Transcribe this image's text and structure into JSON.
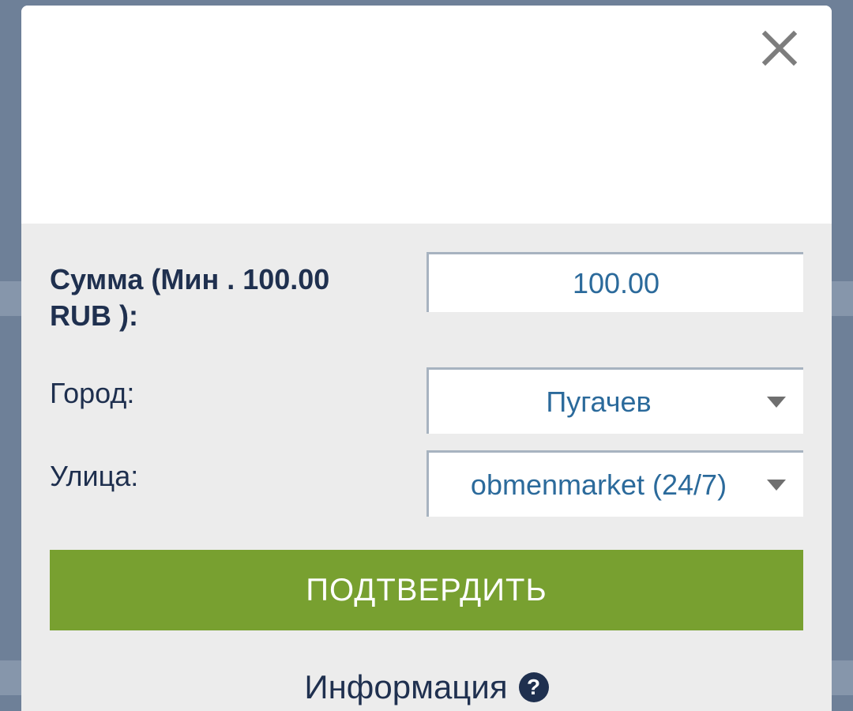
{
  "modal": {
    "close_icon": "close-icon"
  },
  "form": {
    "amount": {
      "label": "Сумма (Мин . 100.00 RUB ):",
      "value": "100.00"
    },
    "city": {
      "label": "Город:",
      "value": "Пугачев"
    },
    "street": {
      "label": "Улица:",
      "value": "obmenmarket (24/7)"
    },
    "confirm_label": "ПОДТВЕРДИТЬ"
  },
  "info": {
    "label": "Информация",
    "icon": "help-icon",
    "icon_glyph": "?"
  },
  "colors": {
    "confirm_bg": "#78a030",
    "text_dark": "#1f304f",
    "value_blue": "#2b6a9b",
    "backdrop": "#6e8098"
  }
}
